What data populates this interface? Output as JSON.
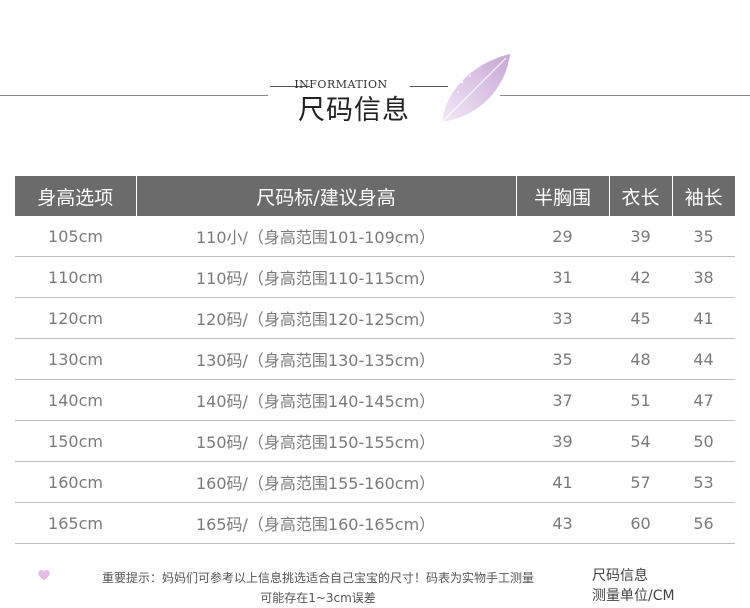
{
  "header": {
    "info_label": "INFORMATION",
    "title": "尺码信息"
  },
  "table": {
    "columns": [
      "身高选项",
      "尺码标/建议身高",
      "半胸围",
      "衣长",
      "袖长"
    ],
    "rows": [
      [
        "105cm",
        "110小/（身高范围101-109cm）",
        "29",
        "39",
        "35"
      ],
      [
        "110cm",
        "110码/（身高范围110-115cm）",
        "31",
        "42",
        "38"
      ],
      [
        "120cm",
        "120码/（身高范围120-125cm）",
        "33",
        "45",
        "41"
      ],
      [
        "130cm",
        "130码/（身高范围130-135cm）",
        "35",
        "48",
        "44"
      ],
      [
        "140cm",
        "140码/（身高范围140-145cm）",
        "37",
        "51",
        "47"
      ],
      [
        "150cm",
        "150码/（身高范围150-155cm）",
        "39",
        "54",
        "50"
      ],
      [
        "160cm",
        "160码/（身高范围155-160cm）",
        "41",
        "57",
        "53"
      ],
      [
        "165cm",
        "165码/（身高范围160-165cm）",
        "43",
        "60",
        "56"
      ]
    ]
  },
  "footer": {
    "tip_line1": "重要提示：妈妈们可参考以上信息挑选适合自己宝宝的尺寸！码表为实物手工测量",
    "tip_line2": "可能存在1~3cm误差",
    "unit_line1": "尺码信息",
    "unit_line2": "测量单位/CM"
  },
  "colors": {
    "header_bg": "#6b6b6b",
    "leaf": "#d9c4e3",
    "heart": "#e8b9e8"
  },
  "icons": [
    "leaf-icon",
    "heart-icon"
  ]
}
